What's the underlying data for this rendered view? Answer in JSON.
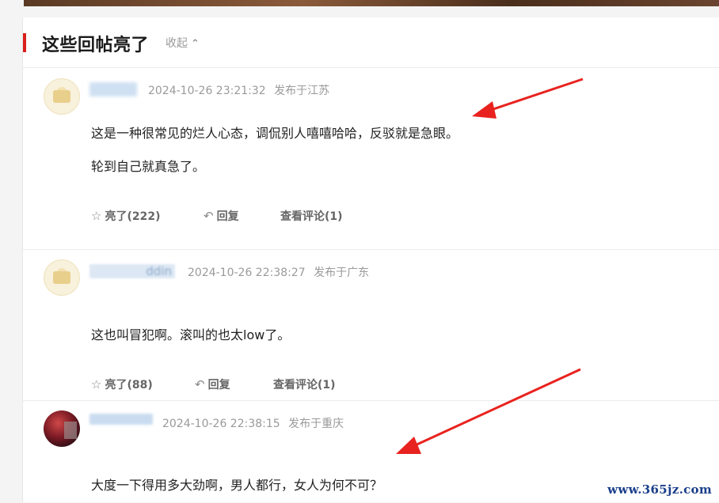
{
  "section": {
    "title": "这些回帖亮了",
    "collapse_label": "收起",
    "accent_color": "#d8211c"
  },
  "comments": [
    {
      "username": "",
      "time": "2024-10-26 23:21:32",
      "location": "发布于江苏",
      "lines": [
        "这是一种很常见的烂人心态，调侃别人嘻嘻哈哈，反驳就是急眼。",
        "轮到自己就真急了。"
      ],
      "like_label": "亮了(222)",
      "reply_label": "回复",
      "view_label": "查看评论(1)"
    },
    {
      "username": "ddin",
      "time": "2024-10-26 22:38:27",
      "location": "发布于广东",
      "lines": [
        "这也叫冒犯啊。滚叫的也太low了。"
      ],
      "like_label": "亮了(88)",
      "reply_label": "回复",
      "view_label": "查看评论(1)"
    },
    {
      "username": "",
      "time": "2024-10-26 22:38:15",
      "location": "发布于重庆",
      "lines": [
        "大度一下得用多大劲啊，男人都行，女人为何不可？"
      ]
    }
  ],
  "watermark": "www.365jz.com",
  "icons": {
    "like": "lightbulb-icon",
    "reply": "reply-arrow-icon",
    "collapse": "chevron-up-icon"
  },
  "arrow_color": "#e8231f"
}
